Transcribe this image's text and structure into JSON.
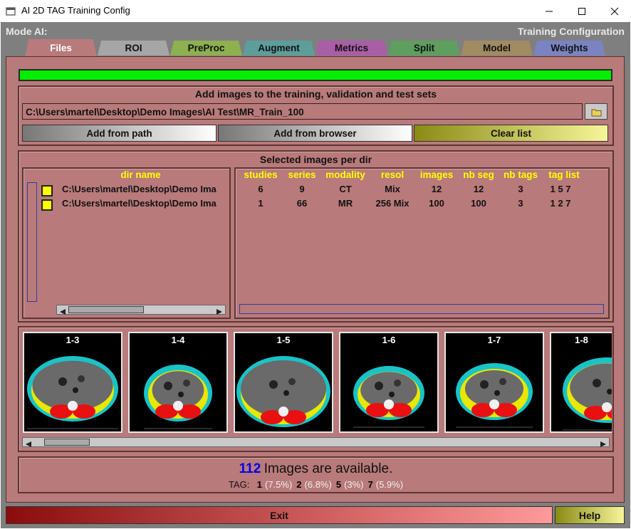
{
  "window": {
    "title": "AI 2D TAG Training Config"
  },
  "header": {
    "mode": "Mode AI:",
    "config": "Training Configuration"
  },
  "tabs": [
    {
      "label": "Files",
      "color": "#b87a7a"
    },
    {
      "label": "ROI",
      "color": "#a6a6a6"
    },
    {
      "label": "PreProc",
      "color": "#8db050"
    },
    {
      "label": "Augment",
      "color": "#5e9e9a"
    },
    {
      "label": "Metrics",
      "color": "#a95ea5"
    },
    {
      "label": "Split",
      "color": "#5e9e5e"
    },
    {
      "label": "Model",
      "color": "#a08b63"
    },
    {
      "label": "Weights",
      "color": "#7a84c2"
    }
  ],
  "files": {
    "progress": 1.0,
    "add_group": {
      "title": "Add images to the training, validation and test sets",
      "path": "C:\\Users\\martel\\Desktop\\Demo Images\\AI Test\\MR_Train_100",
      "add_from_path": "Add from path",
      "add_from_browser": "Add from browser",
      "clear_list": "Clear list"
    },
    "selected_group": {
      "title": "Selected images per dir",
      "dir_header": "dir name",
      "columns": [
        "studies",
        "series",
        "modality",
        "resol",
        "images",
        "nb seg",
        "nb tags",
        "tag list"
      ],
      "rows": [
        {
          "dir": "C:\\Users\\martel\\Desktop\\Demo Ima",
          "studies": "6",
          "series": "9",
          "modality": "CT",
          "resol": "Mix",
          "images": "12",
          "nb_seg": "12",
          "nb_tags": "3",
          "tag_list": "1 5 7"
        },
        {
          "dir": "C:\\Users\\martel\\Desktop\\Demo Ima",
          "studies": "1",
          "series": "66",
          "modality": "MR",
          "resol": "256 Mix",
          "images": "100",
          "nb_seg": "100",
          "nb_tags": "3",
          "tag_list": "1 2 7"
        }
      ]
    },
    "thumbnails": [
      "1-3",
      "1-4",
      "1-5",
      "1-6",
      "1-7",
      "1-8"
    ],
    "status": {
      "count": "112",
      "count_text": "Images are available.",
      "tag_label": "TAG:",
      "tags": [
        {
          "id": "1",
          "pct": "(7.5%)"
        },
        {
          "id": "2",
          "pct": "(6.8%)"
        },
        {
          "id": "5",
          "pct": "(3%)"
        },
        {
          "id": "7",
          "pct": "(5.9%)"
        }
      ]
    }
  },
  "footer": {
    "exit": "Exit",
    "help": "Help"
  }
}
